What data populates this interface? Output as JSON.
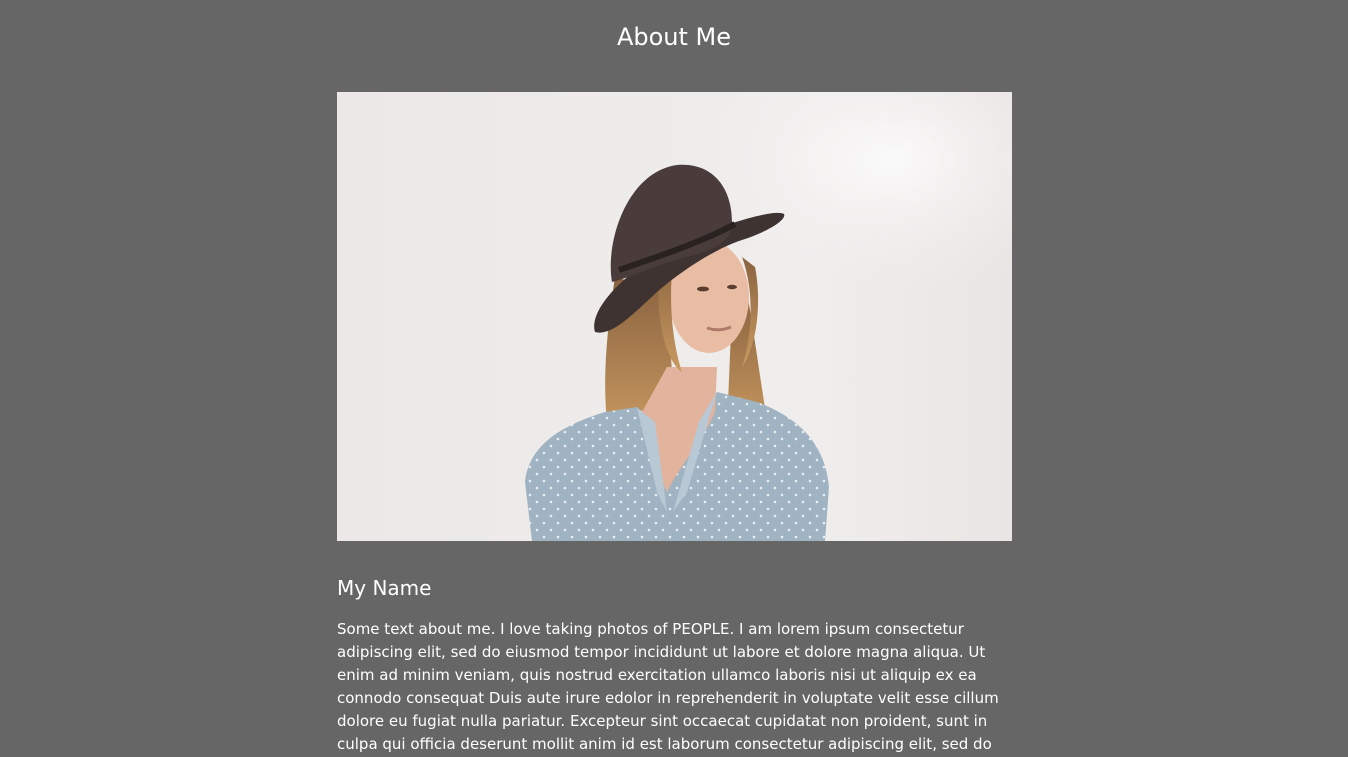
{
  "page": {
    "title": "About Me"
  },
  "photo": {
    "subject": "woman-with-hat-photo"
  },
  "profile": {
    "name": "My Name",
    "bio": "Some text about me. I love taking photos of PEOPLE. I am lorem ipsum consectetur adipiscing elit, sed do eiusmod tempor incididunt ut labore et dolore magna aliqua. Ut enim ad minim veniam, quis nostrud exercitation ullamco laboris nisi ut aliquip ex ea connodo consequat Duis aute irure edolor in reprehenderit in voluptate velit esse cillum dolore eu fugiat nulla pariatur. Excepteur sint occaecat cupidatat non proident, sunt in culpa qui officia deserunt mollit anim id est laborum consectetur adipiscing elit, sed do eiusmod"
  },
  "colors": {
    "background": "#666666",
    "text": "#ffffff",
    "photo_background": "#eeebea"
  }
}
